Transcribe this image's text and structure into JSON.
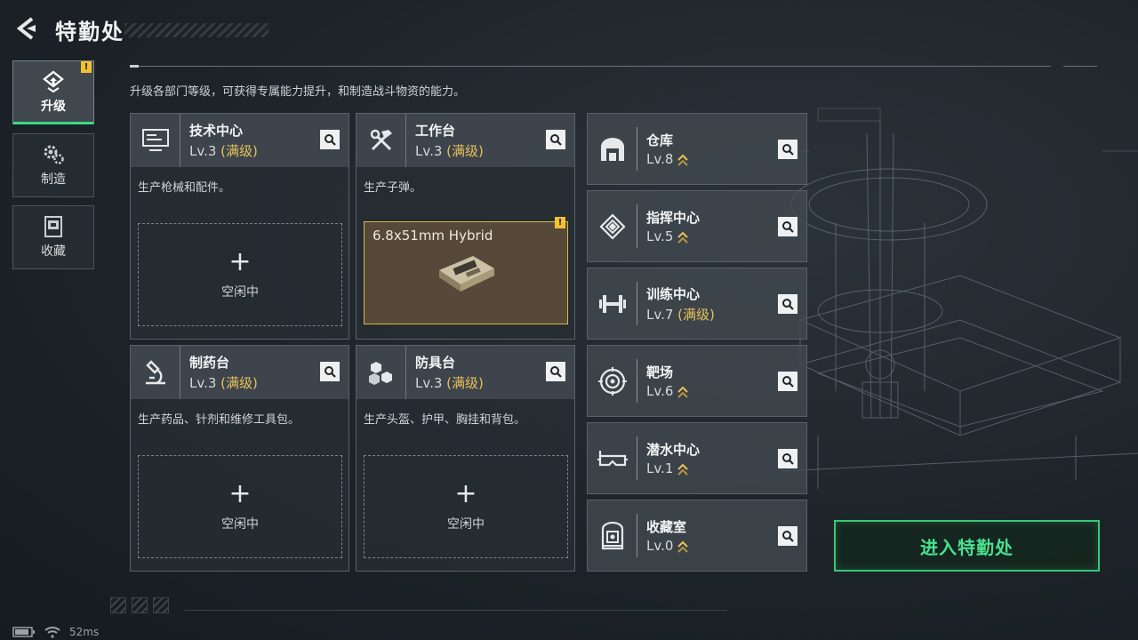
{
  "header": {
    "title": "特勤处"
  },
  "description": "升级各部门等级，可获得专属能力提升，和制造战斗物资的能力。",
  "nav": [
    {
      "label": "升级",
      "icon": "upgrade-icon",
      "active": true,
      "alert": "!"
    },
    {
      "label": "制造",
      "icon": "gear-icon",
      "active": false
    },
    {
      "label": "收藏",
      "icon": "collection-icon",
      "active": false
    }
  ],
  "cards": [
    {
      "name": "技术中心",
      "level": "Lv.3",
      "max": "(满级)",
      "desc": "生产枪械和配件。",
      "slot": {
        "plus": "+",
        "status": "空闲中"
      }
    },
    {
      "name": "工作台",
      "level": "Lv.3",
      "max": "(满级)",
      "desc": "生产子弹。",
      "slot_item": {
        "name": "6.8x51mm Hybrid",
        "alert": "!"
      }
    },
    {
      "name": "制药台",
      "level": "Lv.3",
      "max": "(满级)",
      "desc": "生产药品、针剂和维修工具包。",
      "slot": {
        "plus": "+",
        "status": "空闲中"
      }
    },
    {
      "name": "防具台",
      "level": "Lv.3",
      "max": "(满级)",
      "desc": "生产头盔、护甲、胸挂和背包。",
      "slot": {
        "plus": "+",
        "status": "空闲中"
      }
    }
  ],
  "facilities": [
    {
      "name": "仓库",
      "level": "Lv.8",
      "max": "",
      "upgradable": true
    },
    {
      "name": "指挥中心",
      "level": "Lv.5",
      "max": "",
      "upgradable": true
    },
    {
      "name": "训练中心",
      "level": "Lv.7",
      "max": "(满级)",
      "upgradable": false
    },
    {
      "name": "靶场",
      "level": "Lv.6",
      "max": "",
      "upgradable": true
    },
    {
      "name": "潜水中心",
      "level": "Lv.1",
      "max": "",
      "upgradable": true
    },
    {
      "name": "收藏室",
      "level": "Lv.0",
      "max": "",
      "upgradable": true
    }
  ],
  "enter_button": {
    "label": "进入特勤处"
  },
  "status_bar": {
    "ping": "52ms"
  },
  "colors": {
    "accent_green": "#49e08f",
    "max_level": "#e8c15a",
    "alert": "#f2c12e"
  }
}
